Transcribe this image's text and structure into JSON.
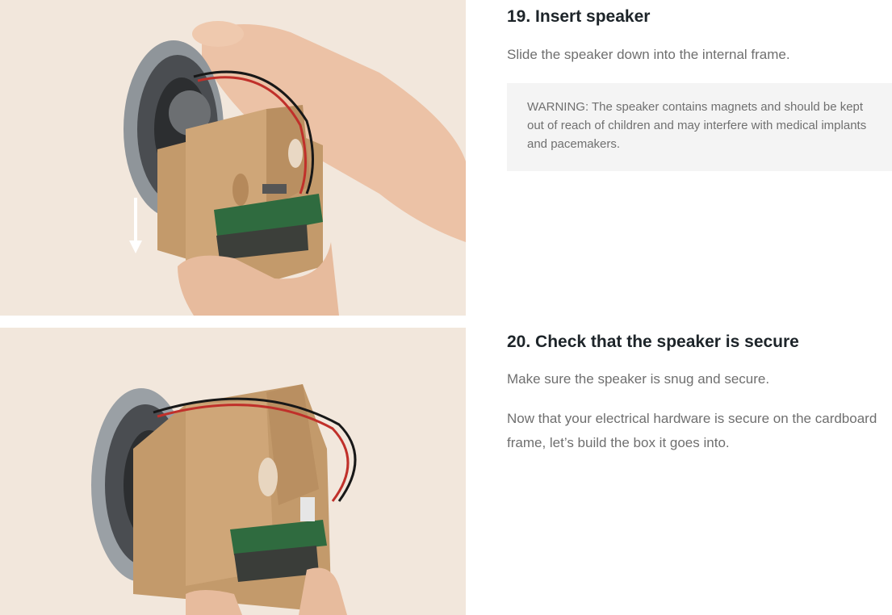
{
  "steps": [
    {
      "title": "19. Insert speaker",
      "paragraphs": [
        "Slide the speaker down into the internal frame."
      ],
      "warning": "WARNING: The speaker contains magnets and should be kept out of reach of children and may interfere with medical implants and pacemakers.",
      "image_alt": "Hand sliding a speaker down into a cardboard internal frame holding a circuit board"
    },
    {
      "title": "20. Check that the speaker is secure",
      "paragraphs": [
        "Make sure the speaker is snug and secure.",
        "Now that your electrical hardware is secure on the cardboard frame, let’s build the box it goes into."
      ],
      "image_alt": "Hand holding the assembled cardboard frame with the speaker secured"
    }
  ],
  "colors": {
    "title": "#1d2429",
    "body_text": "#6f6f6f",
    "warning_bg": "#f4f4f4",
    "photo_bg": "#f1e6da",
    "cardboard": "#c49a6c"
  }
}
